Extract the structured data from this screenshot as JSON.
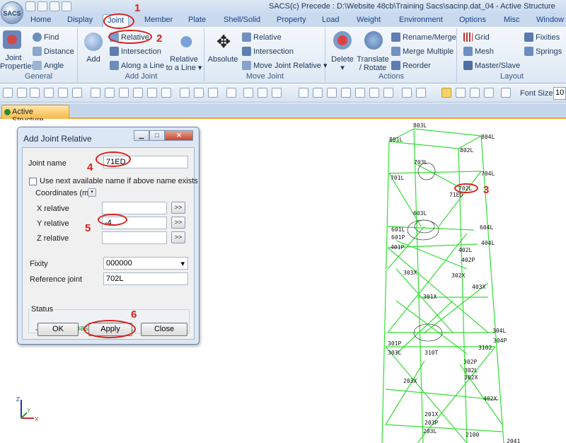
{
  "window": {
    "title": "SACS(c) Precede : D:\\Website 48cb\\Training Sacs\\sacinp.dat_04 - Active Structure",
    "logo": "SACS"
  },
  "ribbon_tabs": [
    "Home",
    "Display",
    "Joint",
    "Member",
    "Plate",
    "Shell/Solid",
    "Property",
    "Load",
    "Weight",
    "Environment",
    "Options",
    "Misc",
    "Window"
  ],
  "active_tab": "Joint",
  "groups": {
    "general": {
      "label": "General",
      "joint_properties": "Joint Properties",
      "find": "Find",
      "distance": "Distance",
      "angle": "Angle"
    },
    "add_joint": {
      "label": "Add Joint",
      "add": "Add",
      "relative": "Relative",
      "intersection": "Intersection",
      "along_a_line": "Along a Line",
      "relative_to_a_line_1": "Relative",
      "relative_to_a_line_2": "to a Line"
    },
    "move_joint": {
      "label": "Move Joint",
      "absolute": "Absolute",
      "relative": "Relative",
      "intersection": "Intersection",
      "move_joint_relative": "Move Joint Relative"
    },
    "actions": {
      "label": "Actions",
      "delete": "Delete",
      "translate_1": "Translate",
      "translate_2": "/ Rotate",
      "rename_merge": "Rename/Merge",
      "merge_multiple": "Merge Multiple",
      "reorder": "Reorder"
    },
    "layout": {
      "label": "Layout",
      "grid": "Grid",
      "mesh": "Mesh",
      "master_slave": "Master/Slave",
      "fixities": "Fixities",
      "springs": "Springs"
    }
  },
  "toolbar": {
    "font_size_label": "Font Size",
    "font_size_value": "10"
  },
  "document_tab": "Active Structure",
  "dialog": {
    "title": "Add Joint Relative",
    "joint_name_label": "Joint name",
    "joint_name_value": "71ED",
    "use_next_label": "Use next available name if above name exists",
    "coordinates_label": "Coordinates  (m)",
    "x_label": "X relative",
    "y_label": "Y relative",
    "z_label": "Z relative",
    "x_value": "",
    "y_value": "-4.",
    "z_value": "",
    "arrow": ">>",
    "fixity_label": "Fixity",
    "fixity_value": "000000",
    "reference_joint_label": "Reference joint",
    "reference_joint_value": "702L",
    "status_label": "Status",
    "status_text": "Joint  71ED has been added.",
    "ok": "OK",
    "apply": "Apply",
    "close": "Close"
  },
  "annotations": [
    "1",
    "2",
    "3",
    "4",
    "5",
    "6"
  ],
  "axis": {
    "z": "Z",
    "y": "Y",
    "x": "X"
  },
  "joint_labels": [
    {
      "t": "803L"
    },
    {
      "t": "804L"
    },
    {
      "t": "801L"
    },
    {
      "t": "802L"
    },
    {
      "t": "703L"
    },
    {
      "t": "701L"
    },
    {
      "t": "704L"
    },
    {
      "t": "702L"
    },
    {
      "t": "71ED"
    },
    {
      "t": "603L"
    },
    {
      "t": "601L"
    },
    {
      "t": "604L"
    },
    {
      "t": "601P"
    },
    {
      "t": "404L"
    },
    {
      "t": "401P"
    },
    {
      "t": "402L"
    },
    {
      "t": "402P"
    },
    {
      "t": "303X"
    },
    {
      "t": "302X"
    },
    {
      "t": "403X"
    },
    {
      "t": "301X"
    },
    {
      "t": "304L"
    },
    {
      "t": "301P"
    },
    {
      "t": "304P"
    },
    {
      "t": "303L"
    },
    {
      "t": "3102"
    },
    {
      "t": "310T"
    },
    {
      "t": "302P"
    },
    {
      "t": "302L"
    },
    {
      "t": "302X"
    },
    {
      "t": "203X"
    },
    {
      "t": "402X"
    },
    {
      "t": "201X"
    },
    {
      "t": "203P"
    },
    {
      "t": "203L"
    },
    {
      "t": "2100"
    },
    {
      "t": "2041"
    }
  ]
}
